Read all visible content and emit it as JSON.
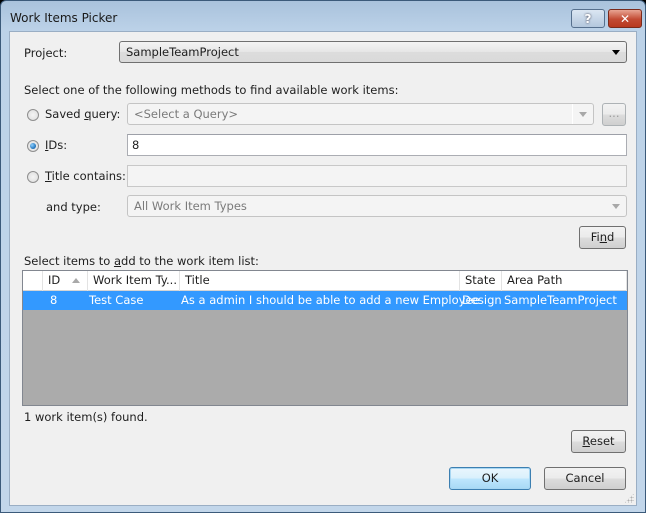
{
  "window": {
    "title": "Work Items Picker",
    "help_icon": "question-mark-icon",
    "close_icon": "close-x-icon"
  },
  "project": {
    "label": "Project:",
    "value": "SampleTeamProject"
  },
  "methods": {
    "instruction": "Select one of the following methods to find available work items:",
    "saved_query": {
      "label_pre": "Saved ",
      "label_accel": "q",
      "label_post": "uery:",
      "placeholder": "<Select a Query>",
      "browse_label": "...",
      "selected": false
    },
    "ids": {
      "label_accel": "I",
      "label_post": "Ds:",
      "value": "8",
      "selected": true
    },
    "title_contains": {
      "label_accel": "T",
      "label_post": "itle contains:",
      "value": "",
      "selected": false
    },
    "type": {
      "label": "and type:",
      "value": "All Work Item Types"
    },
    "find_button": {
      "label_pre": "Fi",
      "label_accel": "n",
      "label_post": "d"
    }
  },
  "results": {
    "instruction_pre": "Select items to ",
    "instruction_accel": "a",
    "instruction_post": "dd to the work item list:",
    "columns": [
      "ID",
      "Work Item Ty...",
      "Title",
      "State",
      "Area Path"
    ],
    "sort_column": "ID",
    "sort_direction": "ascending",
    "rows": [
      {
        "id": "8",
        "type": "Test Case",
        "title": "As a admin I should be able to add a new Employee",
        "state": "Design",
        "area_path": "SampleTeamProject",
        "selected": true
      }
    ],
    "status": "1 work item(s) found."
  },
  "buttons": {
    "reset": {
      "label_accel": "R",
      "label_post": "eset"
    },
    "ok": "OK",
    "cancel": "Cancel"
  },
  "colors": {
    "selection": "#3399ff",
    "grid_empty": "#ababab",
    "dialog_bg": "#f0f0f0"
  }
}
